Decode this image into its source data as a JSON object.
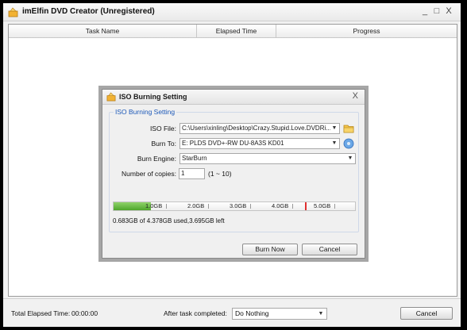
{
  "window": {
    "title": "imElfin DVD Creator (Unregistered)",
    "controls": {
      "minimize": "_",
      "maximize": "□",
      "close": "X"
    }
  },
  "task_list": {
    "columns": [
      "Task Name",
      "Elapsed Time",
      "Progress"
    ]
  },
  "status_bar": {
    "elapsed_label": "Total Elapsed Time:",
    "elapsed_value": "00:00:00",
    "after_task_label": "After task completed:",
    "after_task_value": "Do Nothing",
    "cancel_label": "Cancel"
  },
  "dialog": {
    "title": "ISO Burning Setting",
    "close": "X",
    "group_title": "ISO Burning Setting",
    "iso_file_label": "ISO File:",
    "iso_file_value": "C:\\Users\\xinling\\Desktop\\Crazy.Stupid.Love.DVDRi...",
    "burn_to_label": "Burn To:",
    "burn_to_value": "E: PLDS DVD+-RW DU-8A3S KD01",
    "burn_engine_label": "Burn Engine:",
    "burn_engine_value": "StarBurn",
    "copies_label": "Number of copies:",
    "copies_value": "1",
    "copies_range": "(1 ~ 10)",
    "capacity_ticks": [
      "1.0GB",
      "2.0GB",
      "3.0GB",
      "4.0GB",
      "5.0GB"
    ],
    "capacity_used_fraction": 0.156,
    "capacity_limit_fraction": 0.794,
    "capacity_info": "0.683GB of 4.378GB used,3.695GB left",
    "burn_now_label": "Burn Now",
    "cancel_label": "Cancel"
  },
  "colors": {
    "accent_blue": "#1c58b8",
    "capacity_green": "#4ea52b",
    "capacity_limit_red": "#e03030"
  }
}
